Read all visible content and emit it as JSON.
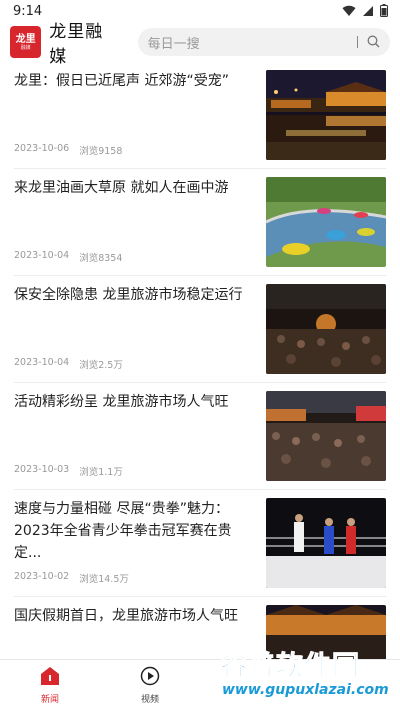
{
  "status_bar": {
    "time": "9:14"
  },
  "header": {
    "logo_text": "龙里",
    "logo_subtext": "融媒",
    "app_title": "龙里融媒",
    "search_placeholder": "每日一搜"
  },
  "news": [
    {
      "title": "龙里：假日已近尾声 近郊游“受宠”",
      "date": "2023-10-06",
      "views": "浏览9158",
      "image": "night-waterfront-photo"
    },
    {
      "title": "来龙里油画大草原 就如人在画中游",
      "date": "2023-10-04",
      "views": "浏览8354",
      "image": "bumper-boats-photo"
    },
    {
      "title": "保安全除隐患 龙里旅游市场稳定运行",
      "date": "2023-10-04",
      "views": "浏览2.5万",
      "image": "night-crowd-photo"
    },
    {
      "title": "活动精彩纷呈 龙里旅游市场人气旺",
      "date": "2023-10-03",
      "views": "浏览1.1万",
      "image": "festival-crowd-photo"
    },
    {
      "title": "速度与力量相碰 尽展“贵拳”魅力：2023年全省青少年拳击冠军赛在贵定...",
      "date": "2023-10-02",
      "views": "浏览14.5万",
      "image": "boxing-ring-photo"
    },
    {
      "title": "国庆假期首日，龙里旅游市场人气旺",
      "date": "",
      "views": "",
      "image": "night-town-photo"
    }
  ],
  "tabs": [
    {
      "label": "新闻",
      "icon": "news-home-icon",
      "active": true
    },
    {
      "label": "视频",
      "icon": "play-circle-icon",
      "active": false
    },
    {
      "label": "",
      "icon": "",
      "active": false
    },
    {
      "label": "",
      "icon": "",
      "active": false
    }
  ],
  "watermark": {
    "main": "谷普软件园",
    "url": "www.gupuxlazai.com"
  },
  "colors": {
    "brand": "#d8262d",
    "watermark": "#1a9ad6"
  }
}
